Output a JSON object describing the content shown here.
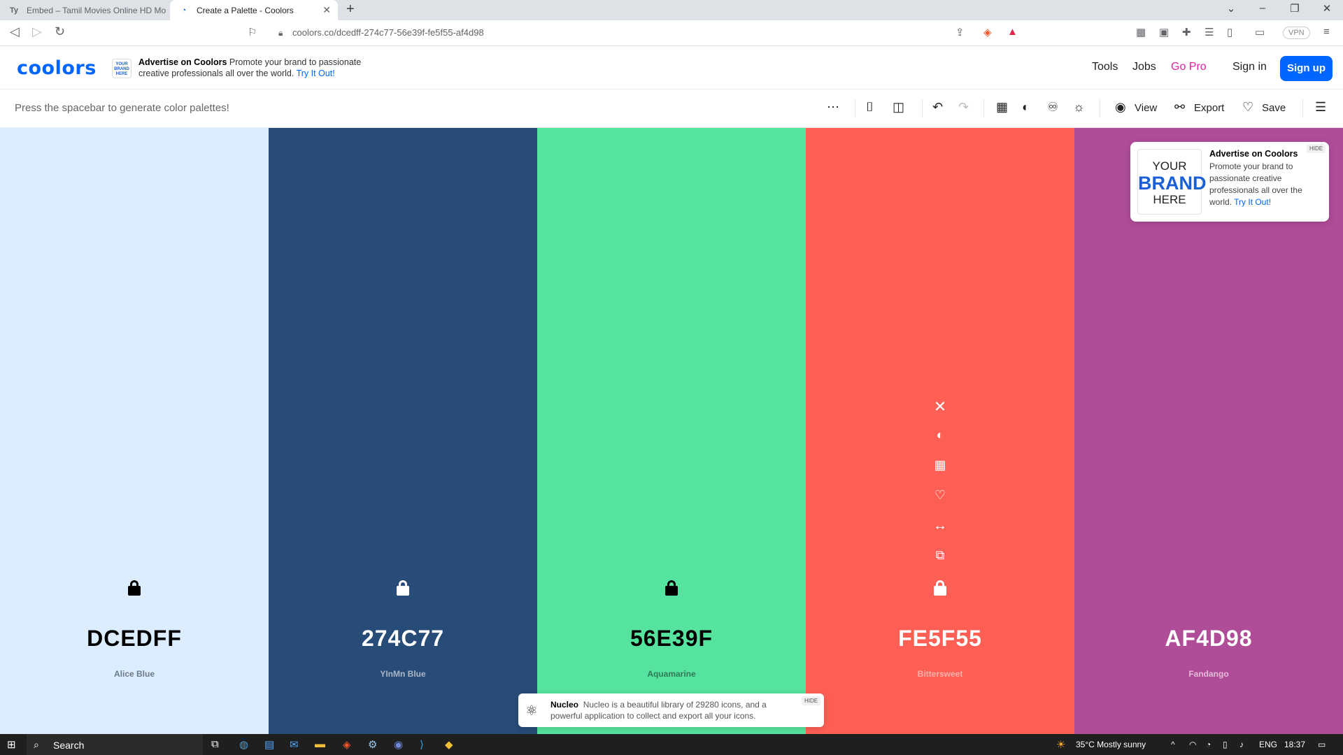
{
  "browser": {
    "tabs": [
      {
        "label": "Embed – Tamil Movies Online HD Mo",
        "favicon": "Ty"
      },
      {
        "label": "Create a Palette - Coolors",
        "favicon": "C"
      }
    ],
    "url": "coolors.co/dcedff-274c77-56e39f-fe5f55-af4d98",
    "vpn_label": "VPN"
  },
  "header": {
    "logo": "coolors",
    "ad": {
      "logo_text": "YOUR BRAND HERE",
      "title": "Advertise on Coolors",
      "body": "Promote your brand to passionate creative professionals all over the world.",
      "link": "Try It Out!"
    },
    "nav": {
      "tools": "Tools",
      "jobs": "Jobs",
      "gopro": "Go Pro",
      "signin": "Sign in",
      "signup": "Sign up"
    }
  },
  "toolbar": {
    "hint": "Press the spacebar to generate color palettes!",
    "view_label": "View",
    "export_label": "Export",
    "save_label": "Save"
  },
  "palette": {
    "colors": [
      {
        "hex": "DCEDFF",
        "name": "Alice Blue",
        "bg": "#dcedff",
        "fg": "#000000",
        "name_color": "#6b7a88"
      },
      {
        "hex": "274C77",
        "name": "YInMn Blue",
        "bg": "#274c77",
        "fg": "#ffffff",
        "name_color": "#a9b7c8"
      },
      {
        "hex": "56E39F",
        "name": "Aquamarine",
        "bg": "#56e39f",
        "fg": "#000000",
        "name_color": "#2f7a55"
      },
      {
        "hex": "FE5F55",
        "name": "Bittersweet",
        "bg": "#fe5f55",
        "fg": "#ffffff",
        "name_color": "#ffb0aa"
      },
      {
        "hex": "AF4D98",
        "name": "Fandango",
        "bg": "#af4d98",
        "fg": "#ffffff",
        "name_color": "#e3bcd9"
      }
    ]
  },
  "ad_card": {
    "logo_lines": [
      "YOUR",
      "BRAND",
      "HERE"
    ],
    "title": "Advertise on Coolors",
    "body": "Promote your brand to passionate creative professionals all over the world.",
    "link": "Try It Out!",
    "hide": "HIDE"
  },
  "toast": {
    "title": "Nucleo",
    "body": "Nucleo is a beautiful library of 29280 icons, and a powerful application to collect and export all your icons.",
    "hide": "HIDE"
  },
  "taskbar": {
    "search_label": "Search",
    "weather": "35°C  Mostly sunny",
    "lang": "ENG",
    "time": "18:37"
  }
}
